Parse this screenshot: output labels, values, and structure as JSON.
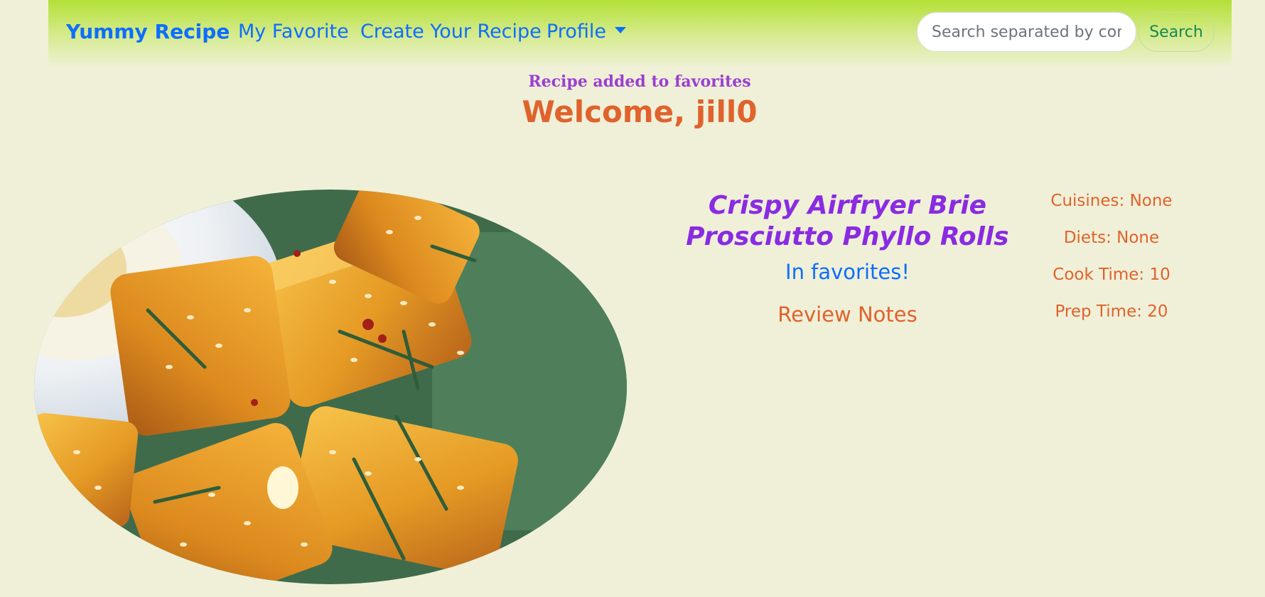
{
  "navbar": {
    "brand": "Yummy Recipe",
    "links": [
      {
        "label": "My Favorite"
      },
      {
        "label": "Create Your Recipe"
      },
      {
        "label": "Profile"
      }
    ],
    "search": {
      "placeholder": "Search separated by comma",
      "value": "",
      "button_label": "Search"
    }
  },
  "flash_message": "Recipe added to favorites",
  "welcome": "Welcome, jill0",
  "recipe": {
    "title": "Crispy Airfryer Brie Prosciutto Phyllo Rolls",
    "favorite_status": "In favorites!",
    "review_notes_label": "Review Notes",
    "cuisines": "Cuisines: None",
    "diets": "Diets: None",
    "cook_time": "Cook Time: 10",
    "prep_time": "Prep Time: 20",
    "image_subject": "crispy phyllo rolls with sesame seeds and rosemary"
  },
  "colors": {
    "background": "#f0f0d8",
    "navbar_top": "#b4e036",
    "link": "#0d6efd",
    "accent_orange": "#e0622c",
    "accent_purple": "#8a2be2",
    "flash_purple": "#9b3fd0",
    "search_green": "#198754"
  }
}
